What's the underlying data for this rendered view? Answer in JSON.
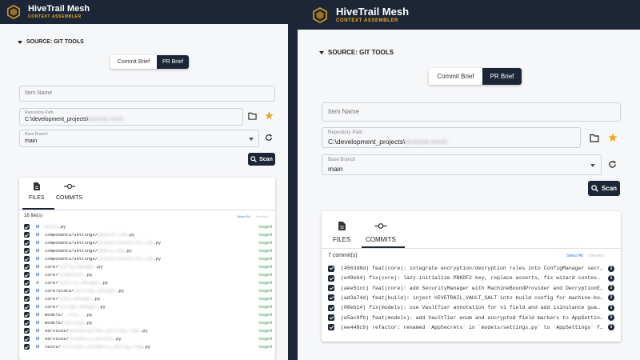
{
  "app": {
    "title": "HiveTrail Mesh",
    "subtitle": "CONTEXT ASSEMBLER",
    "brand_color": "#1c2636",
    "accent_color": "#f2a81d"
  },
  "source": {
    "section_label": "SOURCE: GIT TOOLS",
    "brief_toggle": {
      "commit_label": "Commit Brief",
      "pr_label": "PR Brief",
      "active": "pr"
    },
    "item_name_placeholder": "Item Name",
    "repo_path_label": "Repository Path",
    "repo_path_value": "C:\\development_projects\\",
    "repo_path_hidden": "hivetrail-mesh",
    "base_branch_label": "Base Branch",
    "base_branch_value": "main",
    "scan_label": "Scan",
    "icons": [
      "folder-icon",
      "star-icon",
      "refresh-icon",
      "search-icon",
      "chevron-down-icon"
    ]
  },
  "tabs": {
    "files_label": "FILES",
    "commits_label": "COMMITS"
  },
  "files": {
    "count_label": "16 file(s)",
    "select_all": "Select All",
    "deselect": "Deselect",
    "status_label": "staged",
    "items": [
      {
        "status": "M",
        "prefix": "",
        "hidden": "build",
        "suffix": ".py"
      },
      {
        "status": "M",
        "prefix": "components/settings/",
        "hidden": "general_tab",
        "suffix": ".py"
      },
      {
        "status": "M",
        "prefix": "components/settings/",
        "hidden": "github/connection_tab",
        "suffix": ".py"
      },
      {
        "status": "M",
        "prefix": "components/settings/",
        "hidden": "models_tab",
        "suffix": ".py"
      },
      {
        "status": "M",
        "prefix": "components/settings/",
        "hidden": "notion/connection_tab",
        "suffix": ".py"
      },
      {
        "status": "M",
        "prefix": "core/",
        "hidden": "config_manager",
        "suffix": ".py"
      },
      {
        "status": "M",
        "prefix": "core/",
        "hidden": "exceptions",
        "suffix": ".py"
      },
      {
        "status": "A",
        "prefix": "core/",
        "hidden": "security_manager",
        "suffix": ".py"
      },
      {
        "status": "M",
        "prefix": "core/state/",
        "hidden": "settings_manager",
        "suffix": ".py"
      },
      {
        "status": "M",
        "prefix": "core/",
        "hidden": "state_manager",
        "suffix": ".py"
      },
      {
        "status": "M",
        "prefix": "core/",
        "hidden": "storage_manager",
        "suffix": ".py"
      },
      {
        "status": "M",
        "prefix": "models/",
        "hidden": "__init__",
        "suffix": ".py"
      },
      {
        "status": "M",
        "prefix": "models/",
        "hidden": "settings",
        "suffix": ".py"
      },
      {
        "status": "M",
        "prefix": "services/",
        "hidden": "github/github_settings_repo",
        "suffix": ".py"
      },
      {
        "status": "M",
        "prefix": "services/",
        "hidden": "telemetry_service",
        "suffix": ".py"
      },
      {
        "status": "M",
        "prefix": "tests/",
        "hidden": "core/test_telemetry_dialog_flag",
        "suffix": ".py"
      }
    ]
  },
  "commits": {
    "count_label": "7 commit(s)",
    "select_all": "Select All",
    "deselect": "Deselect",
    "items": [
      {
        "sha": "(4563d8d)",
        "msg": "feat(core): integrate encryption/decryption rules into ConfigManager secr…"
      },
      {
        "sha": "(e49eb4)",
        "msg": "fix(core): lazy-initialize PBKDF2 key, replace asserts, fix wizard contex…"
      },
      {
        "sha": "(aee51cc)",
        "msg": "feat(core): add SecurityManager with MachineBoundProvider and DecryptionE…"
      },
      {
        "sha": "(ad3a74d)",
        "msg": "feat(build): inject HIVETRAIL_VAULT_SALT into build config for machine-bo…"
      },
      {
        "sha": "(08eb14)",
        "msg": "fix(models): use VaultTier annotation for v1 field and add isinstance gua…"
      },
      {
        "sha": "(e5ac0fb)",
        "msg": "feat(models): add VaultTier enum and encrypted field markers to AppSettin…"
      },
      {
        "sha": "(ee448c9)",
        "msg": "refactor: renamed `AppSecrets` in `models/settings.py` to `AppSettings` f…"
      }
    ]
  }
}
